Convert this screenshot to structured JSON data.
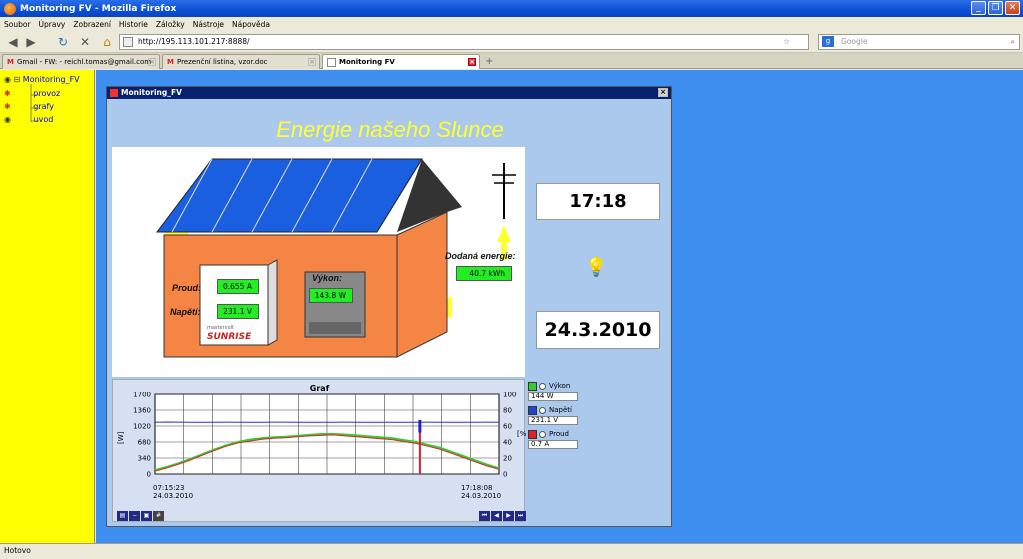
{
  "browser": {
    "title": "Monitoring FV - Mozilla Firefox",
    "menu": [
      "Soubor",
      "Úpravy",
      "Zobrazení",
      "Historie",
      "Záložky",
      "Nástroje",
      "Nápověda"
    ],
    "url": "http://195.113.101.217:8888/",
    "search_placeholder": "Google",
    "tabs": [
      {
        "label": "Gmail - FW: - reichl.tomas@gmail.com"
      },
      {
        "label": "Prezenční listina, vzor.doc"
      },
      {
        "label": "Monitoring FV"
      }
    ],
    "status": "Hotovo"
  },
  "tree": {
    "root": "Monitoring_FV",
    "items": [
      "provoz",
      "grafy",
      "uvod"
    ]
  },
  "app": {
    "window_title": "Monitoring_FV",
    "headline": "Energie našeho Slunce",
    "clock": "17:18",
    "date": "24.3.2010",
    "labels": {
      "proud": "Proud:",
      "napeti": "Napětí:",
      "vykon": "Výkon:",
      "dodana": "Dodaná energie:"
    },
    "values": {
      "proud": "0.655 A",
      "napeti": "231.1 V",
      "vykon": "143.8 W",
      "dodana": "40.7 kWh"
    },
    "inverter_brand": "SUNRISE",
    "inverter_maker": "mastervolt"
  },
  "legend": [
    {
      "name": "Výkon",
      "value": "144 W",
      "color": "#22aa22"
    },
    {
      "name": "Napětí",
      "value": "231.1 V",
      "color": "#2244cc"
    },
    {
      "name": "Proud",
      "value": "0.7 A",
      "color": "#dd2222"
    }
  ],
  "chart_data": {
    "type": "line",
    "title": "Graf",
    "ylabel": "[W]",
    "ylabel_right": "[%]",
    "yticks_left": [
      0,
      340,
      680,
      1020,
      1360,
      1700
    ],
    "yticks_right": [
      0,
      20,
      40,
      60,
      80,
      100
    ],
    "ylim": [
      0,
      1700
    ],
    "ylim_right": [
      0,
      100
    ],
    "x_start": "07:15:23",
    "x_start_date": "24.03.2010",
    "x_end": "17:18:08",
    "x_end_date": "24.03.2010",
    "series": [
      {
        "name": "Výkon",
        "color": "#33cc33",
        "values": [
          80,
          150,
          230,
          320,
          420,
          520,
          610,
          680,
          730,
          760,
          780,
          790,
          810,
          830,
          850,
          850,
          840,
          820,
          800,
          780,
          760,
          720,
          680,
          620,
          560,
          470,
          380,
          290,
          200,
          120
        ]
      },
      {
        "name": "Proud",
        "color": "#dd2222",
        "values": [
          60,
          130,
          210,
          300,
          400,
          500,
          590,
          660,
          700,
          740,
          760,
          770,
          790,
          810,
          820,
          830,
          810,
          790,
          770,
          750,
          730,
          690,
          650,
          590,
          530,
          440,
          350,
          260,
          170,
          100
        ]
      },
      {
        "name": "Napětí",
        "color": "#2233cc",
        "values": [
          1100,
          1105,
          1102,
          1100,
          1098,
          1100,
          1102,
          1101,
          1099,
          1100,
          1102,
          1103,
          1100,
          1101,
          1099,
          1100,
          1102,
          1100,
          1098,
          1100,
          1101,
          1099,
          1100,
          1102,
          1100,
          1101,
          1099,
          1100,
          1102,
          1100
        ]
      }
    ]
  }
}
